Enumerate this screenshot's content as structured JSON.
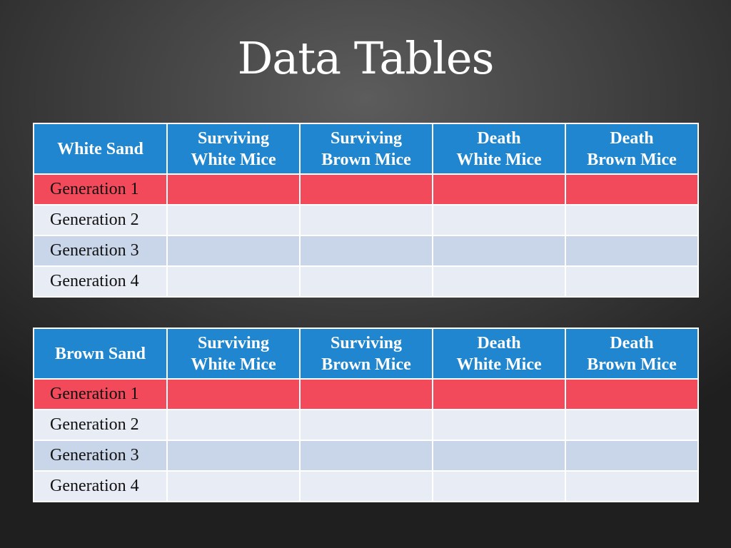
{
  "slide": {
    "title": "Data Tables"
  },
  "colors": {
    "header": "#1f86cf",
    "highlight_row": "#f24a5a",
    "row_light": "#e8ecf5",
    "row_mid": "#c9d6ea",
    "title": "#ffffff"
  },
  "tables": [
    {
      "corner": "White Sand",
      "columns": [
        {
          "line1": "Surviving",
          "line2": "White Mice"
        },
        {
          "line1": "Surviving",
          "line2": "Brown Mice"
        },
        {
          "line1": "Death",
          "line2": "White Mice"
        },
        {
          "line1": "Death",
          "line2": "Brown Mice"
        }
      ],
      "rows": [
        {
          "label": "Generation 1",
          "cells": [
            "",
            "",
            "",
            ""
          ]
        },
        {
          "label": "Generation 2",
          "cells": [
            "",
            "",
            "",
            ""
          ]
        },
        {
          "label": "Generation 3",
          "cells": [
            "",
            "",
            "",
            ""
          ]
        },
        {
          "label": "Generation 4",
          "cells": [
            "",
            "",
            "",
            ""
          ]
        }
      ]
    },
    {
      "corner": "Brown Sand",
      "columns": [
        {
          "line1": "Surviving",
          "line2": "White Mice"
        },
        {
          "line1": "Surviving",
          "line2": "Brown Mice"
        },
        {
          "line1": "Death",
          "line2": "White Mice"
        },
        {
          "line1": "Death",
          "line2": "Brown Mice"
        }
      ],
      "rows": [
        {
          "label": "Generation 1",
          "cells": [
            "",
            "",
            "",
            ""
          ]
        },
        {
          "label": "Generation 2",
          "cells": [
            "",
            "",
            "",
            ""
          ]
        },
        {
          "label": "Generation 3",
          "cells": [
            "",
            "",
            "",
            ""
          ]
        },
        {
          "label": "Generation 4",
          "cells": [
            "",
            "",
            "",
            ""
          ]
        }
      ]
    }
  ]
}
